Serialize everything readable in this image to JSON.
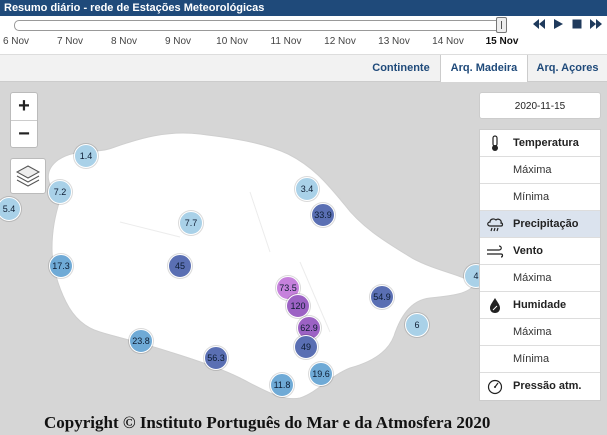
{
  "header": {
    "title": "Resumo diário - rede de Estações Meteorológicas"
  },
  "timeline": {
    "ticks": [
      "6 Nov",
      "7 Nov",
      "8 Nov",
      "9 Nov",
      "10 Nov",
      "11 Nov",
      "12 Nov",
      "13 Nov",
      "14 Nov",
      "15 Nov"
    ],
    "active_tick": "15 Nov",
    "controls": [
      "skip-back",
      "play",
      "stop",
      "skip-forward"
    ]
  },
  "tabs": [
    {
      "label": "Continente",
      "active": false
    },
    {
      "label": "Arq. Madeira",
      "active": true
    },
    {
      "label": "Arq. Açores",
      "active": false
    }
  ],
  "map": {
    "zoom_in": "+",
    "zoom_out": "−",
    "markers": [
      "5.4",
      "1.4",
      "7.2",
      "3.4",
      "33.9",
      "7.7",
      "17.3",
      "45",
      "73.5",
      "120",
      "54.9",
      "4",
      "6",
      "62.9",
      "49",
      "23.8",
      "56.3",
      "11.8",
      "19.6"
    ]
  },
  "panel": {
    "date": "2020-11-15",
    "items": [
      {
        "label": "Temperatura",
        "type": "main",
        "icon": "thermometer-icon"
      },
      {
        "label": "Máxima",
        "type": "sub"
      },
      {
        "label": "Mínima",
        "type": "sub"
      },
      {
        "label": "Precipitação",
        "type": "main",
        "icon": "rain-cloud-icon",
        "selected": true
      },
      {
        "label": "Vento",
        "type": "main",
        "icon": "wind-icon"
      },
      {
        "label": "Máxima",
        "type": "sub"
      },
      {
        "label": "Humidade",
        "type": "main",
        "icon": "humidity-drop-icon"
      },
      {
        "label": "Máxima",
        "type": "sub"
      },
      {
        "label": "Mínima",
        "type": "sub"
      },
      {
        "label": "Pressão atm.",
        "type": "main",
        "icon": "pressure-gauge-icon"
      }
    ]
  },
  "copyright": "Copyright © Instituto Português do Mar e da Atmosfera 2020",
  "colors": {
    "titlebar": "#1f4a7a",
    "map_bg": "#d6d6d6",
    "island": "#ffffff",
    "selected": "#dbe3ee"
  }
}
